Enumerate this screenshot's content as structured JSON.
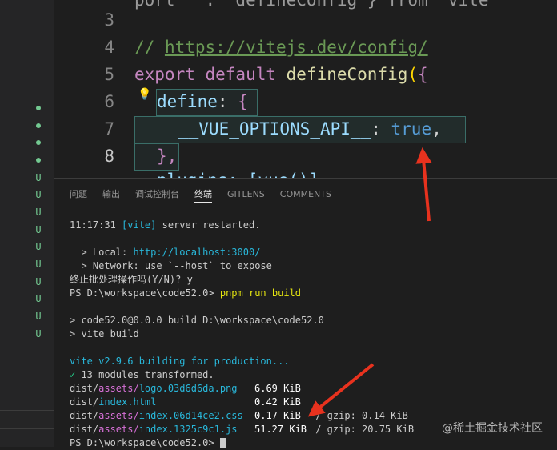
{
  "editor": {
    "lines": [
      {
        "number": "3",
        "text": ""
      },
      {
        "number": "4",
        "comment_prefix": "// ",
        "link": "https://vitejs.dev/config/"
      },
      {
        "number": "5",
        "kw": "export default ",
        "fn": "defineConfig",
        "paren": "(",
        "brace": "{"
      },
      {
        "number": "6",
        "prop": "define",
        "colon": ": ",
        "brace": "{"
      },
      {
        "number": "7",
        "prop": "__VUE_OPTIONS_API__",
        "colon": ": ",
        "bool": "true",
        "comma": ","
      },
      {
        "number": "8",
        "close": "},"
      }
    ],
    "partial_top": "port   .  defineConfig } from 'vite'",
    "partial_bottom": "plugins: [vue()],"
  },
  "sidebar": {
    "markers": [
      "•",
      "•",
      "•",
      "•",
      "U",
      "U",
      "U",
      "U",
      "U",
      "U",
      "U",
      "U",
      "U",
      "U"
    ]
  },
  "panel": {
    "tabs": [
      "问题",
      "输出",
      "调试控制台",
      "终端",
      "GITLENS",
      "COMMENTS"
    ],
    "active_tab": "终端"
  },
  "terminal": {
    "l1_time": "11:17:31 ",
    "l1_tag": "[vite]",
    "l1_rest": " server restarted.",
    "l2": "",
    "l3_a": "  > Local: ",
    "l3_url": "http://localhost:3000/",
    "l4": "  > Network: use `--host` to expose",
    "l5": "终止批处理操作吗(Y/N)? y",
    "l6_prompt": "PS D:\\workspace\\code52.0> ",
    "l6_cmd": "pnpm run build",
    "l7": "",
    "l8": "> code52.0@0.0.0 build D:\\workspace\\code52.0",
    "l9": "> vite build",
    "l10": "",
    "l11": "vite v2.9.6 building for production...",
    "l12_check": "✓",
    "l12_rest": " 13 modules transformed.",
    "files": [
      {
        "dir": "dist/",
        "sub": "assets/",
        "name": "logo.03d6d6da.png",
        "size": "6.69 KiB",
        "gzip": ""
      },
      {
        "dir": "dist/",
        "sub": "",
        "name": "index.html",
        "size": "0.42 KiB",
        "gzip": ""
      },
      {
        "dir": "dist/",
        "sub": "assets/",
        "name": "index.06d14ce2.css",
        "size": "0.17 KiB",
        "gzip": " / gzip: 0.14 KiB"
      },
      {
        "dir": "dist/",
        "sub": "assets/",
        "name": "index.1325c9c1.js",
        "size": "51.27 KiB",
        "gzip": " / gzip: 20.75 KiB"
      }
    ],
    "last_prompt": "PS D:\\workspace\\code52.0> "
  },
  "watermark": "@稀土掘金技术社区",
  "colors": {
    "background": "#1e1e1e",
    "annotation_arrow": "#e8321e",
    "git_untracked": "#73c991"
  }
}
